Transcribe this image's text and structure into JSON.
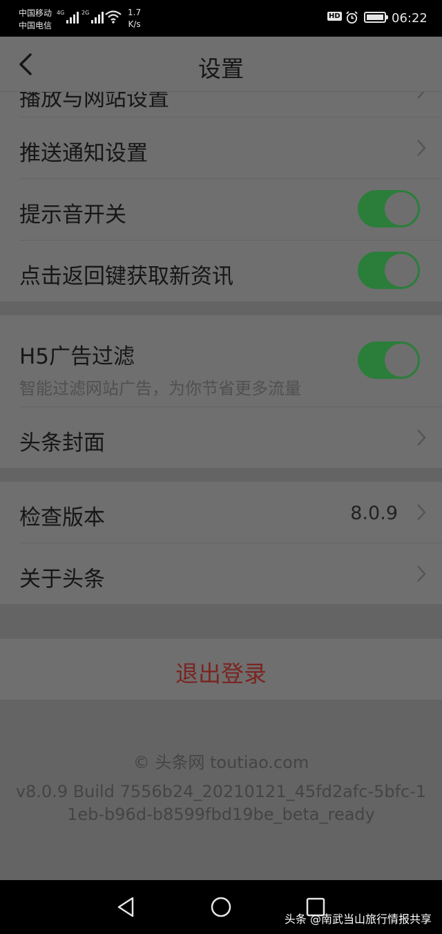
{
  "status_bar": {
    "carrier_1": "中国移动",
    "carrier_2": "中国电信",
    "net_1": "4G",
    "net_2": "2G",
    "speed_value": "1.7",
    "speed_unit": "K/s",
    "hd": "HD",
    "time": "06:22"
  },
  "header": {
    "title": "设置",
    "back_icon": "chevron-left-icon"
  },
  "settings": {
    "partial_item": "播放与网站设置",
    "push": "推送通知设置",
    "sound": "提示音开关",
    "sound_on": true,
    "back_refresh": "点击返回键获取新资讯",
    "back_refresh_on": true,
    "h5_filter": "H5广告过滤",
    "h5_filter_desc": "智能过滤网站广告，为你节省更多流量",
    "h5_filter_on": true,
    "cover": "头条封面",
    "check_version": "检查版本",
    "version_value": "8.0.9",
    "about": "关于头条",
    "logout": "退出登录"
  },
  "footer": {
    "copyright": "© 头条网 toutiao.com",
    "build": "v8.0.9 Build 7556b24_20210121_45fd2afc-5bfc-11eb-b96d-b8599fbd19be_beta_ready"
  },
  "nav_bar": {
    "icons": [
      "back-triangle-icon",
      "home-circle-icon",
      "recents-square-icon"
    ],
    "watermark": "头条 @南武当山旅行情报共享"
  },
  "colors": {
    "toggle_on": "#2a7e3a",
    "logout_text": "#7a2520",
    "overlay_background": "#6f6f6f"
  }
}
